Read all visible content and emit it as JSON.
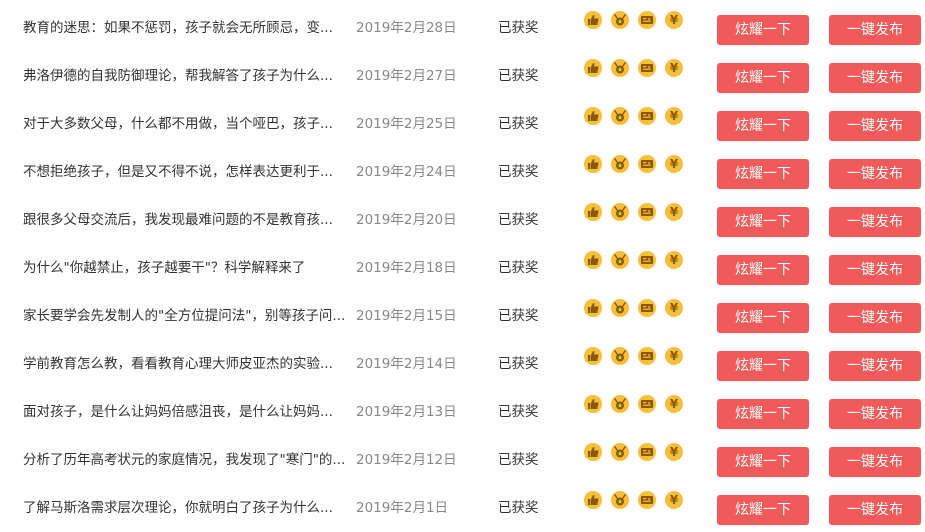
{
  "accent_color": "#f05a5a",
  "icon_color": "#f5be3c",
  "icons": [
    "thumb-up-icon",
    "medal-icon",
    "coupon-icon",
    "yen-icon"
  ],
  "yen_symbol": "¥",
  "articles": [
    {
      "title": "教育的迷思：如果不惩罚，孩子就会无所顾忌，变...",
      "date": "2019年2月28日",
      "status": "已获奖",
      "show_label": "炫耀一下",
      "publish_label": "一键发布"
    },
    {
      "title": "弗洛伊德的自我防御理论，帮我解答了孩子为什么...",
      "date": "2019年2月27日",
      "status": "已获奖",
      "show_label": "炫耀一下",
      "publish_label": "一键发布"
    },
    {
      "title": "对于大多数父母，什么都不用做，当个哑巴，孩子...",
      "date": "2019年2月25日",
      "status": "已获奖",
      "show_label": "炫耀一下",
      "publish_label": "一键发布"
    },
    {
      "title": "不想拒绝孩子，但是又不得不说，怎样表达更利于...",
      "date": "2019年2月24日",
      "status": "已获奖",
      "show_label": "炫耀一下",
      "publish_label": "一键发布"
    },
    {
      "title": "跟很多父母交流后，我发现最难问题的不是教育孩...",
      "date": "2019年2月20日",
      "status": "已获奖",
      "show_label": "炫耀一下",
      "publish_label": "一键发布"
    },
    {
      "title": "为什么\"你越禁止，孩子越要干\"？科学解释来了",
      "date": "2019年2月18日",
      "status": "已获奖",
      "show_label": "炫耀一下",
      "publish_label": "一键发布"
    },
    {
      "title": "家长要学会先发制人的\"全方位提问法\"，别等孩子问...",
      "date": "2019年2月15日",
      "status": "已获奖",
      "show_label": "炫耀一下",
      "publish_label": "一键发布"
    },
    {
      "title": "学前教育怎么教，看看教育心理大师皮亚杰的实验...",
      "date": "2019年2月14日",
      "status": "已获奖",
      "show_label": "炫耀一下",
      "publish_label": "一键发布"
    },
    {
      "title": "面对孩子，是什么让妈妈倍感沮丧，是什么让妈妈...",
      "date": "2019年2月13日",
      "status": "已获奖",
      "show_label": "炫耀一下",
      "publish_label": "一键发布"
    },
    {
      "title": "分析了历年高考状元的家庭情况，我发现了\"寒门\"的...",
      "date": "2019年2月12日",
      "status": "已获奖",
      "show_label": "炫耀一下",
      "publish_label": "一键发布"
    },
    {
      "title": "了解马斯洛需求层次理论，你就明白了孩子为什么...",
      "date": "2019年2月1日",
      "status": "已获奖",
      "show_label": "炫耀一下",
      "publish_label": "一键发布"
    }
  ]
}
